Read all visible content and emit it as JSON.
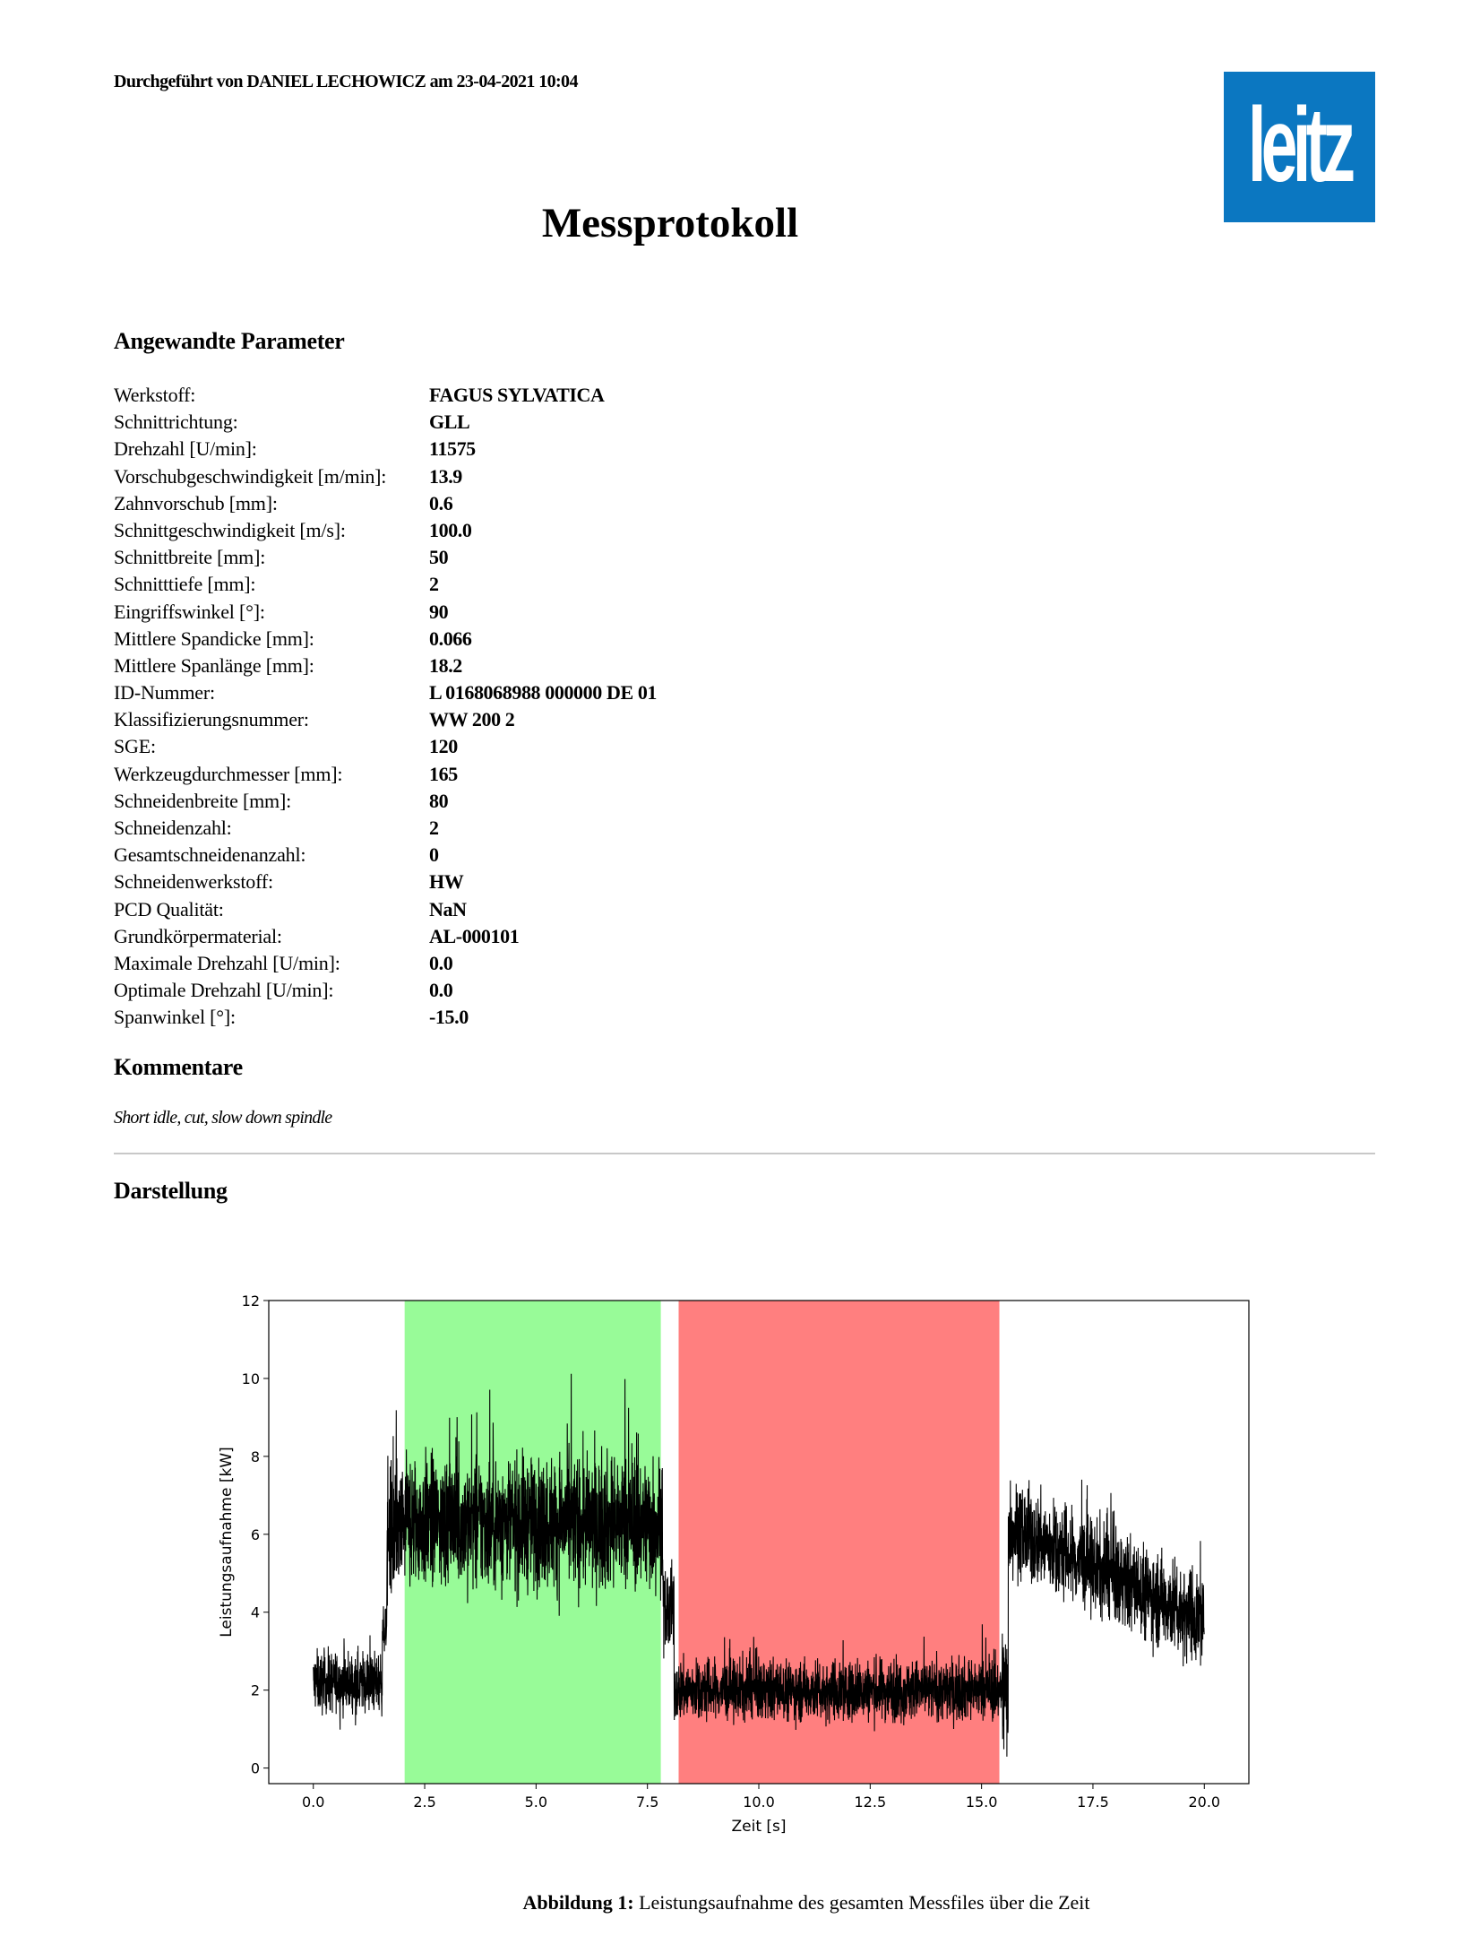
{
  "header": {
    "performed_by": "Durchgeführt von DANIEL LECHOWICZ am 23-04-2021 10:04",
    "logo_text": "leitz",
    "logo_color": "#0b77c1"
  },
  "title": "Messprotokoll",
  "parameters_heading": "Angewandte Parameter",
  "parameters": [
    {
      "label": "Werkstoff:",
      "value": "FAGUS SYLVATICA"
    },
    {
      "label": "Schnittrichtung:",
      "value": "GLL"
    },
    {
      "label": "Drehzahl [U/min]:",
      "value": "11575"
    },
    {
      "label": "Vorschubgeschwindigkeit [m/min]:",
      "value": "13.9"
    },
    {
      "label": "Zahnvorschub [mm]:",
      "value": "0.6"
    },
    {
      "label": "Schnittgeschwindigkeit [m/s]:",
      "value": "100.0"
    },
    {
      "label": "Schnittbreite [mm]:",
      "value": "50"
    },
    {
      "label": "Schnitttiefe [mm]:",
      "value": "2"
    },
    {
      "label": "Eingriffswinkel [°]:",
      "value": "90"
    },
    {
      "label": "Mittlere Spandicke [mm]:",
      "value": "0.066"
    },
    {
      "label": "Mittlere Spanlänge [mm]:",
      "value": "18.2"
    },
    {
      "label": "ID-Nummer:",
      "value": "L 0168068988 000000 DE 01"
    },
    {
      "label": "Klassifizierungsnummer:",
      "value": "WW 200 2"
    },
    {
      "label": "SGE:",
      "value": "120"
    },
    {
      "label": "Werkzeugdurchmesser [mm]:",
      "value": "165"
    },
    {
      "label": "Schneidenbreite [mm]:",
      "value": "80"
    },
    {
      "label": "Schneidenzahl:",
      "value": "2"
    },
    {
      "label": "Gesamtschneidenanzahl:",
      "value": "0"
    },
    {
      "label": "Schneidenwerkstoff:",
      "value": "HW"
    },
    {
      "label": "PCD Qualität:",
      "value": "NaN"
    },
    {
      "label": "Grundkörpermaterial:",
      "value": "AL-000101"
    },
    {
      "label": "Maximale Drehzahl [U/min]:",
      "value": "0.0"
    },
    {
      "label": "Optimale Drehzahl [U/min]:",
      "value": "0.0"
    },
    {
      "label": "Spanwinkel [°]:",
      "value": "-15.0"
    }
  ],
  "comments_heading": "Kommentare",
  "comment": "Short idle, cut, slow down spindle",
  "display_heading": "Darstellung",
  "caption": {
    "label": "Abbildung 1:",
    "text": "Leistungsaufnahme des gesamten Messfiles über die Zeit"
  },
  "chart_data": {
    "type": "line",
    "xlabel": "Zeit [s]",
    "ylabel": "Leistungsaufnahme [kW]",
    "xlim": [
      -1.0,
      21.0
    ],
    "ylim": [
      -0.4,
      12.0
    ],
    "xticks": [
      0.0,
      2.5,
      5.0,
      7.5,
      10.0,
      12.5,
      15.0,
      17.5,
      20.0
    ],
    "xtick_labels": [
      "0.0",
      "2.5",
      "5.0",
      "7.5",
      "10.0",
      "12.5",
      "15.0",
      "17.5",
      "20.0"
    ],
    "yticks": [
      0,
      2,
      4,
      6,
      8,
      10,
      12
    ],
    "ytick_labels": [
      "0",
      "2",
      "4",
      "6",
      "8",
      "10",
      "12"
    ],
    "grid": false,
    "shaded_regions": [
      {
        "x_start": 2.05,
        "x_end": 7.8,
        "color": "#98fb98"
      },
      {
        "x_start": 8.2,
        "x_end": 15.4,
        "color": "#ff7f7f"
      }
    ],
    "series": [
      {
        "color": "#000000",
        "segments": [
          {
            "x_start": 0.0,
            "x_end": 1.55,
            "mean": 2.2,
            "noise": 0.55
          },
          {
            "x_start": 1.55,
            "x_end": 1.65,
            "mean": 3.5,
            "noise": 0.4
          },
          {
            "x_start": 1.65,
            "x_end": 2.0,
            "mean": 6.0,
            "noise": 1.3
          },
          {
            "x_start": 2.0,
            "x_end": 7.85,
            "mean": 6.3,
            "noise": 1.2
          },
          {
            "x_start": 7.85,
            "x_end": 8.1,
            "mean": 4.0,
            "noise": 0.8
          },
          {
            "x_start": 8.1,
            "x_end": 15.45,
            "mean": 2.0,
            "noise": 0.55
          },
          {
            "x_start": 15.45,
            "x_end": 15.6,
            "mean": 2.0,
            "noise": 1.2
          },
          {
            "x_start": 15.6,
            "x_end": 20.0,
            "mean_start": 6.2,
            "mean_end": 3.8,
            "noise": 0.85
          }
        ]
      }
    ]
  }
}
